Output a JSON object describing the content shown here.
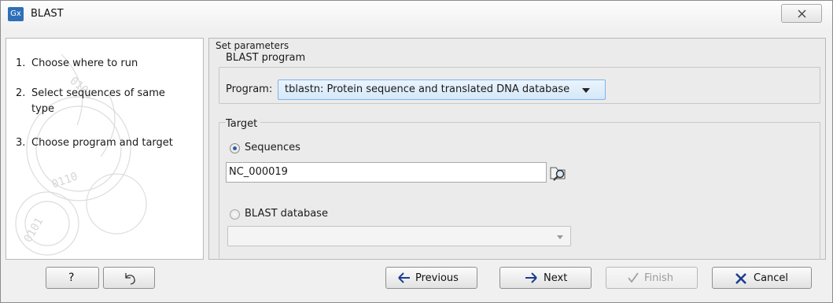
{
  "window": {
    "title": "BLAST",
    "app_icon_text": "Gx"
  },
  "steps": [
    {
      "num": "1.",
      "label": "Choose where to run"
    },
    {
      "num": "2.",
      "label": "Select sequences of same type"
    },
    {
      "num": "3.",
      "label": "Choose program and target"
    }
  ],
  "panel": {
    "header": "Set parameters",
    "program_group": {
      "title": "BLAST program",
      "program_label": "Program:",
      "program_value": "tblastn: Protein sequence and translated DNA database"
    },
    "target_group": {
      "title": "Target",
      "sequences_label": "Sequences",
      "sequences_selected": true,
      "sequences_value": "NC_000019",
      "database_label": "BLAST database",
      "database_selected": false,
      "database_value": ""
    }
  },
  "buttons": {
    "help": "?",
    "reset_icon": "reset-icon",
    "previous": "Previous",
    "next": "Next",
    "finish": "Finish",
    "finish_enabled": false,
    "cancel": "Cancel"
  },
  "colors": {
    "select_highlight": "#d5e8f8",
    "cancel_x": "#1a3d8f",
    "accent": "#2e6fb7"
  }
}
